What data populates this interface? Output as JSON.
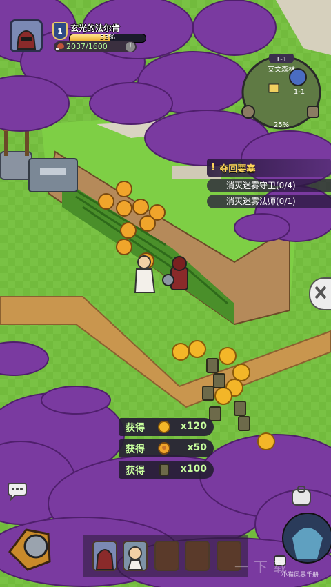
{
  "player": {
    "level": "1",
    "name": "玄光的法尔肯",
    "xp_percent_text": "53%",
    "xp_fraction": 0.53,
    "food_text": "2037/1600"
  },
  "minimap": {
    "stage_label": "1-1",
    "area_name": "艾文森林",
    "node_label": "1-1",
    "exploration_percent": "25%"
  },
  "quest": {
    "title": "夺回要塞",
    "objectives": [
      {
        "text": "消灭迷雾守卫(0/4)"
      },
      {
        "text": "消灭迷雾法师(0/1)"
      }
    ]
  },
  "rewards": [
    {
      "label": "获得",
      "icon": "gold-coin-icon",
      "qty": "x120"
    },
    {
      "label": "获得",
      "icon": "medal-icon",
      "qty": "x50"
    },
    {
      "label": "获得",
      "icon": "rune-card-icon",
      "qty": "x100"
    }
  ],
  "watermark": {
    "big": "一下载",
    "small": "小猫风暴手册"
  },
  "colors": {
    "grass": "#6fb83a",
    "fog": "#7a3aa0",
    "quest_gold": "#ffd55a",
    "reward_green": "#c8ff9e"
  }
}
